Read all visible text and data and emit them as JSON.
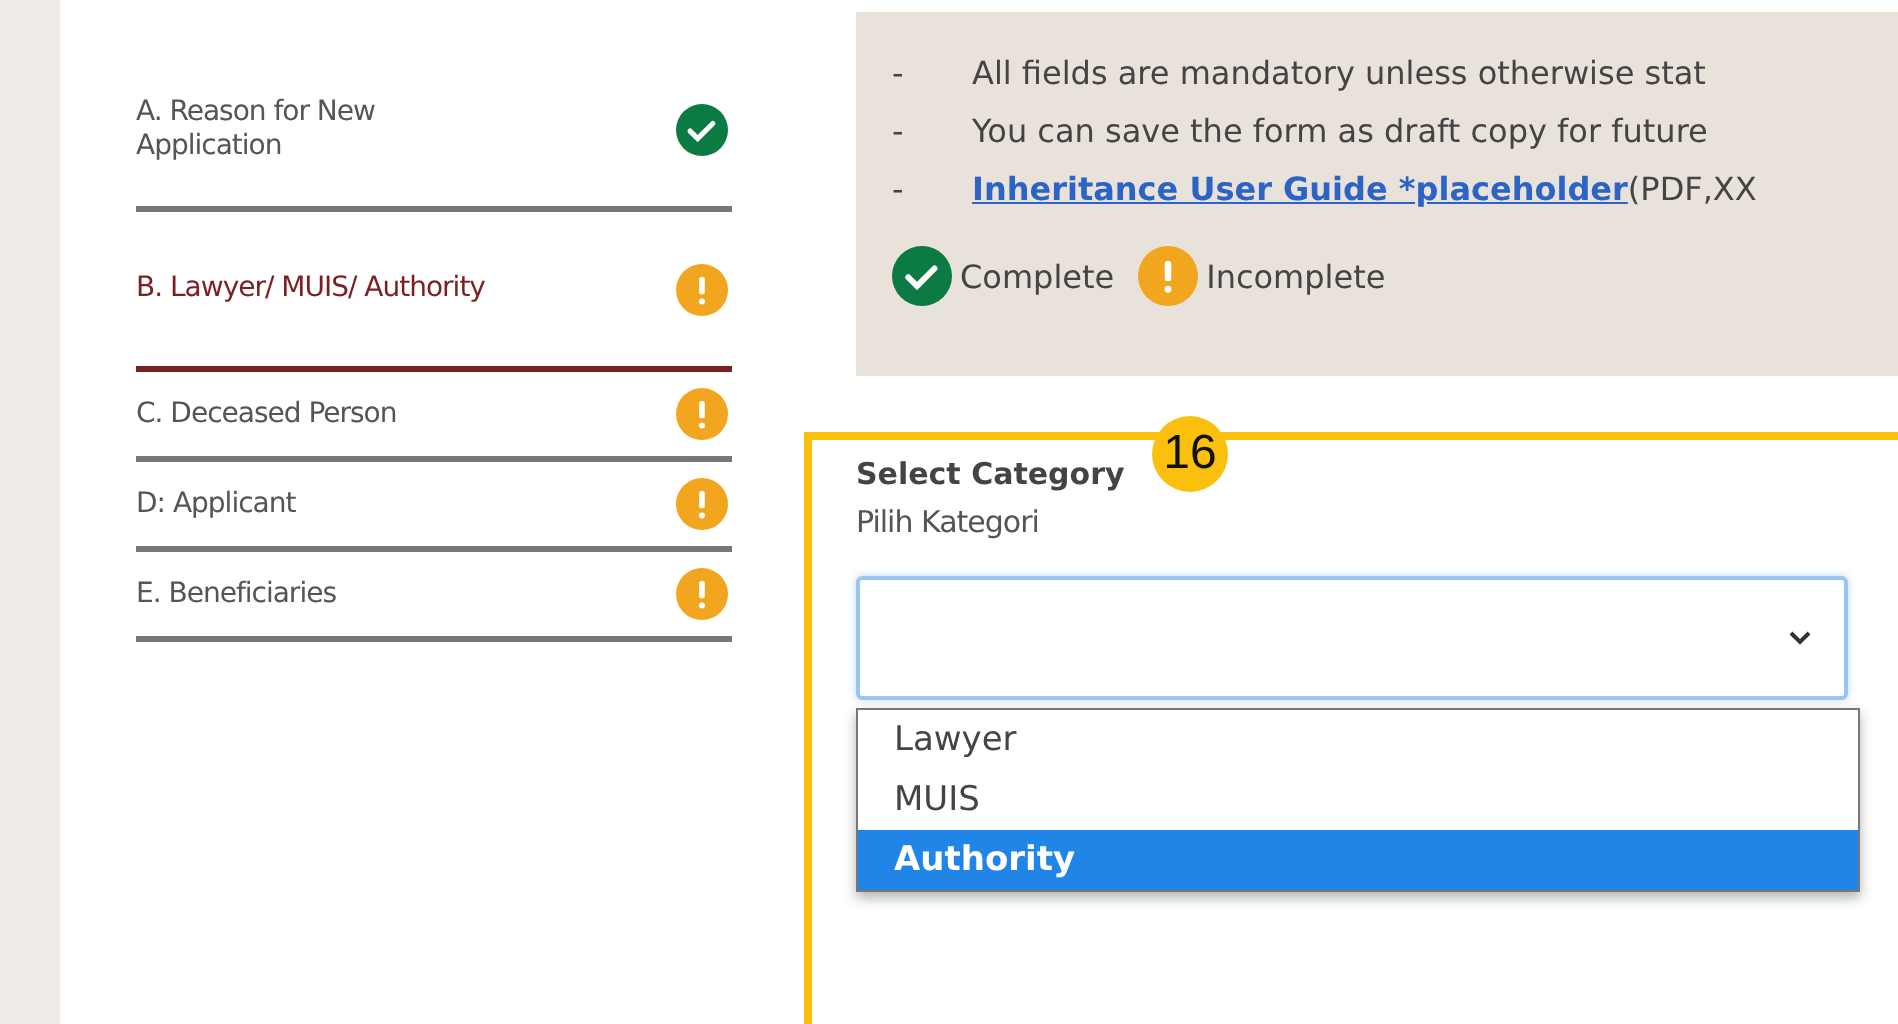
{
  "steps": [
    {
      "label": "A. Reason for New Application",
      "kind": "complete",
      "selected": false
    },
    {
      "label": "B. Lawyer/ MUIS/ Authority",
      "kind": "incomplete",
      "selected": true
    },
    {
      "label": "C. Deceased Person",
      "kind": "incomplete",
      "selected": false
    },
    {
      "label": "D: Applicant",
      "kind": "incomplete",
      "selected": false
    },
    {
      "label": "E. Beneficiaries",
      "kind": "incomplete",
      "selected": false
    }
  ],
  "notes": [
    {
      "kind": "text",
      "bullet": "-",
      "text": "All fields are mandatory unless otherwise stat"
    },
    {
      "kind": "text",
      "bullet": "-",
      "text": "You can save the form as draft copy for future"
    },
    {
      "kind": "link",
      "bullet": "-",
      "link": "Inheritance User Guide *placeholder",
      "text": "(PDF,XX"
    }
  ],
  "legend": [
    {
      "kind": "complete",
      "label": "Complete"
    },
    {
      "kind": "incomplete",
      "label": "Incomplete"
    }
  ],
  "field": {
    "label": "Select Category",
    "sublabel": "Pilih Kategori",
    "options": [
      {
        "label": "Lawyer",
        "selected": false
      },
      {
        "label": "MUIS",
        "selected": false
      },
      {
        "label": "Authority",
        "selected": true
      }
    ]
  },
  "callout": {
    "number": "16"
  }
}
